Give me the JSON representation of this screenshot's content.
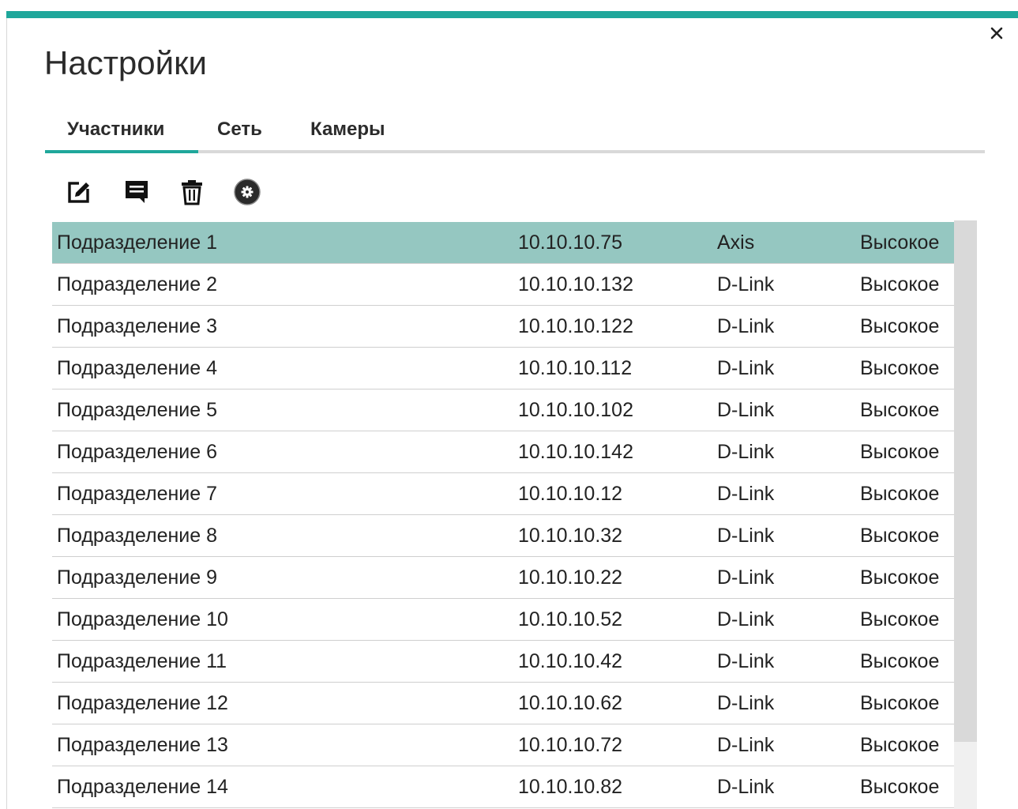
{
  "window": {
    "title": "Настройки",
    "accent_color": "#1fa79b",
    "selected_row_color": "#95c7c1"
  },
  "close_icon": "close-icon",
  "tabs": [
    {
      "label": "Участники",
      "active": true
    },
    {
      "label": "Сеть",
      "active": false
    },
    {
      "label": "Камеры",
      "active": false
    }
  ],
  "toolbar": {
    "icons": [
      "edit-icon",
      "comment-icon",
      "trash-icon",
      "gear-icon"
    ]
  },
  "rows": [
    {
      "name": "Подразделение 1",
      "ip": "10.10.10.75",
      "vendor": "Axis",
      "quality": "Высокое"
    },
    {
      "name": "Подразделение 2",
      "ip": "10.10.10.132",
      "vendor": "D-Link",
      "quality": "Высокое"
    },
    {
      "name": "Подразделение 3",
      "ip": "10.10.10.122",
      "vendor": "D-Link",
      "quality": "Высокое"
    },
    {
      "name": "Подразделение 4",
      "ip": "10.10.10.112",
      "vendor": "D-Link",
      "quality": "Высокое"
    },
    {
      "name": "Подразделение 5",
      "ip": "10.10.10.102",
      "vendor": "D-Link",
      "quality": "Высокое"
    },
    {
      "name": "Подразделение 6",
      "ip": "10.10.10.142",
      "vendor": "D-Link",
      "quality": "Высокое"
    },
    {
      "name": "Подразделение 7",
      "ip": "10.10.10.12",
      "vendor": "D-Link",
      "quality": "Высокое"
    },
    {
      "name": "Подразделение 8",
      "ip": "10.10.10.32",
      "vendor": "D-Link",
      "quality": "Высокое"
    },
    {
      "name": "Подразделение 9",
      "ip": "10.10.10.22",
      "vendor": "D-Link",
      "quality": "Высокое"
    },
    {
      "name": "Подразделение 10",
      "ip": "10.10.10.52",
      "vendor": "D-Link",
      "quality": "Высокое"
    },
    {
      "name": "Подразделение 11",
      "ip": "10.10.10.42",
      "vendor": "D-Link",
      "quality": "Высокое"
    },
    {
      "name": "Подразделение 12",
      "ip": "10.10.10.62",
      "vendor": "D-Link",
      "quality": "Высокое"
    },
    {
      "name": "Подразделение 13",
      "ip": "10.10.10.72",
      "vendor": "D-Link",
      "quality": "Высокое"
    },
    {
      "name": "Подразделение 14",
      "ip": "10.10.10.82",
      "vendor": "D-Link",
      "quality": "Высокое"
    }
  ],
  "selected_row": 0
}
